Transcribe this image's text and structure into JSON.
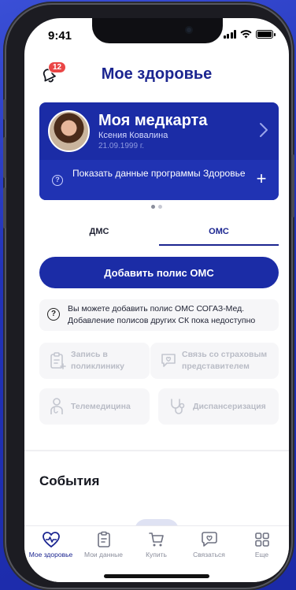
{
  "status_bar": {
    "time": "9:41"
  },
  "header": {
    "title": "Мое здоровье",
    "notification_count": "12"
  },
  "medcard": {
    "title": "Моя медкарта",
    "name": "Ксения Ковалина",
    "birth_date": "21.09.1999 г.",
    "program_link": "Показать данные программы Здоровье"
  },
  "carousel": {
    "pages": 2,
    "active": 0
  },
  "tabs": [
    {
      "label": "ДМС",
      "active": false
    },
    {
      "label": "ОМС",
      "active": true
    }
  ],
  "add_policy_button": "Добавить полис ОМС",
  "info_message": "Вы можете добавить полис ОМС СОГАЗ-Мед. Добавление полисов других СК пока недоступно",
  "actions": [
    {
      "label": "Запись в поликлинику",
      "icon": "clipboard-plus-icon",
      "enabled": false
    },
    {
      "label": "Связь со страховым представителем",
      "icon": "chat-heart-icon",
      "enabled": false
    },
    {
      "label": "Телемедицина",
      "icon": "doctor-icon",
      "enabled": false
    },
    {
      "label": "Диспансеризация",
      "icon": "stethoscope-icon",
      "enabled": false
    }
  ],
  "events_title": "События",
  "tabbar": [
    {
      "label": "Мое здоровье",
      "icon": "heart-pulse-icon",
      "active": true
    },
    {
      "label": "Мои данные",
      "icon": "clipboard-icon",
      "active": false
    },
    {
      "label": "Купить",
      "icon": "cart-icon",
      "active": false
    },
    {
      "label": "Связаться",
      "icon": "chat-heart-icon",
      "active": false
    },
    {
      "label": "Еще",
      "icon": "grid-icon",
      "active": false
    }
  ],
  "colors": {
    "brand": "#1b2590",
    "card": "#1b2ca6",
    "badge": "#ea4646",
    "background": "#2233b8"
  }
}
